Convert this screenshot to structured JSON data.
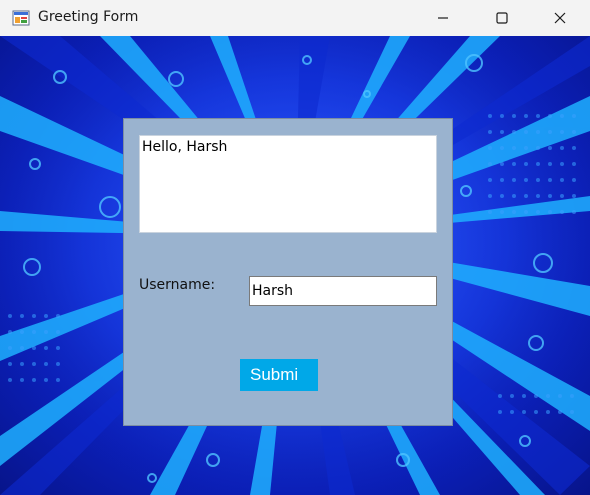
{
  "window": {
    "title": "Greeting Form",
    "icon": "winforms-app-icon",
    "controls": {
      "minimize_icon": "minimize-icon",
      "maximize_icon": "maximize-icon",
      "close_icon": "close-icon"
    }
  },
  "form": {
    "greeting_text": "Hello, Harsh",
    "username_label": "Username:",
    "username_value": "Harsh",
    "submit_label": "Submi"
  },
  "colors": {
    "panel_background": "#9ab3cf",
    "submit_button": "#00a8e8",
    "background_accent": "#1538e0"
  }
}
